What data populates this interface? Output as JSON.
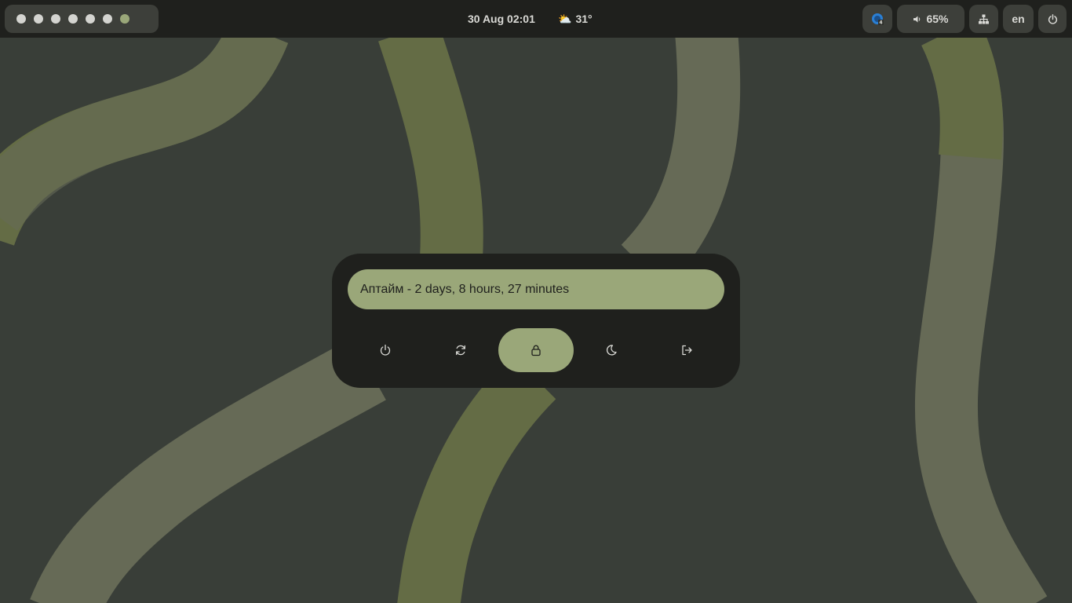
{
  "topbar": {
    "workspaces": [
      {
        "active": false
      },
      {
        "active": false
      },
      {
        "active": false
      },
      {
        "active": false
      },
      {
        "active": false
      },
      {
        "active": false
      },
      {
        "active": true
      }
    ],
    "clock": "30 Aug 02:01",
    "weather": {
      "icon": "partly-cloudy-icon",
      "glyph": "⛅",
      "temperature": "31°"
    },
    "tray_app": {
      "icon": "app-indicator-icon"
    },
    "volume": {
      "icon": "speaker-icon",
      "level": "65%"
    },
    "network": {
      "icon": "network-wired-icon"
    },
    "language": "en",
    "power": {
      "icon": "power-icon"
    }
  },
  "session_dialog": {
    "uptime": "Аптайм - 2 days, 8 hours, 27 minutes",
    "actions": [
      {
        "id": "shutdown",
        "icon": "power-icon",
        "selected": false
      },
      {
        "id": "reboot",
        "icon": "refresh-icon",
        "selected": false
      },
      {
        "id": "lock",
        "icon": "lock-icon",
        "selected": true
      },
      {
        "id": "suspend",
        "icon": "moon-icon",
        "selected": false
      },
      {
        "id": "logout",
        "icon": "logout-icon",
        "selected": false
      }
    ]
  },
  "colors": {
    "bar": "#1f201d",
    "pill": "#3d3f3a",
    "accent": "#9aa779",
    "text": "#d9d9d5",
    "desktop": "#393e38",
    "stripe_olive": "#646c45",
    "stripe_gray": "#666a56"
  }
}
